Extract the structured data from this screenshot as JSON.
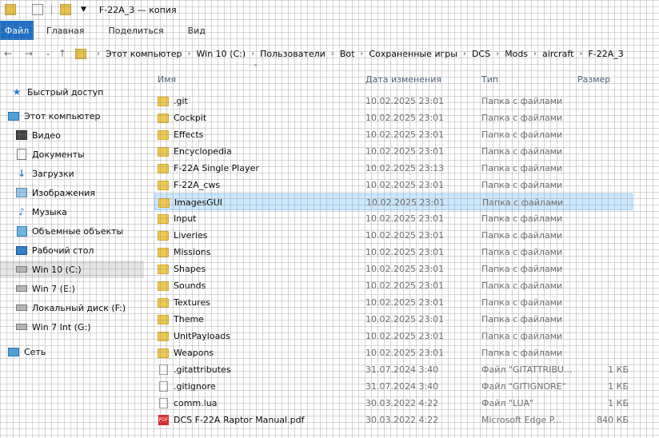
{
  "window": {
    "title": "F-22A_3 — копия"
  },
  "ribbon": {
    "tabs": [
      "Файл",
      "Главная",
      "Поделиться",
      "Вид"
    ]
  },
  "breadcrumb": [
    "Этот компьютер",
    "Win 10 (C:)",
    "Пользователи",
    "Bot",
    "Сохраненные игры",
    "DCS",
    "Mods",
    "aircraft",
    "F-22A_3"
  ],
  "columns": {
    "name": "Имя",
    "date": "Дата изменения",
    "type": "Тип",
    "size": "Размер"
  },
  "sidebar": {
    "items": [
      {
        "label": "Быстрый доступ",
        "icon": "star-icon"
      },
      {
        "label": "Этот компьютер",
        "icon": "computer-icon"
      },
      {
        "label": "Видео",
        "icon": "video-icon"
      },
      {
        "label": "Документы",
        "icon": "documents-icon"
      },
      {
        "label": "Загрузки",
        "icon": "download-icon"
      },
      {
        "label": "Изображения",
        "icon": "pictures-icon"
      },
      {
        "label": "Музыка",
        "icon": "music-icon"
      },
      {
        "label": "Объемные объекты",
        "icon": "3d-objects-icon"
      },
      {
        "label": "Рабочий стол",
        "icon": "desktop-icon"
      },
      {
        "label": "Win 10 (C:)",
        "icon": "drive-icon"
      },
      {
        "label": "Win 7 (E:)",
        "icon": "drive-icon"
      },
      {
        "label": "Локальный диск (F:)",
        "icon": "drive-icon"
      },
      {
        "label": "Win 7 Int (G:)",
        "icon": "drive-icon"
      },
      {
        "label": "Сеть",
        "icon": "network-icon"
      }
    ]
  },
  "files": [
    {
      "name": ".git",
      "date": "10.02.2025 23:01",
      "type": "Папка с файлами",
      "size": "",
      "kind": "folder"
    },
    {
      "name": "Cockpit",
      "date": "10.02.2025 23:01",
      "type": "Папка с файлами",
      "size": "",
      "kind": "folder"
    },
    {
      "name": "Effects",
      "date": "10.02.2025 23:01",
      "type": "Папка с файлами",
      "size": "",
      "kind": "folder"
    },
    {
      "name": "Encyclopedia",
      "date": "10.02.2025 23:01",
      "type": "Папка с файлами",
      "size": "",
      "kind": "folder"
    },
    {
      "name": "F-22A Single Player",
      "date": "10.02.2025 23:13",
      "type": "Папка с файлами",
      "size": "",
      "kind": "folder"
    },
    {
      "name": "F-22A_cws",
      "date": "10.02.2025 23:01",
      "type": "Папка с файлами",
      "size": "",
      "kind": "folder"
    },
    {
      "name": "ImagesGUI",
      "date": "10.02.2025 23:01",
      "type": "Папка с файлами",
      "size": "",
      "kind": "folder"
    },
    {
      "name": "Input",
      "date": "10.02.2025 23:01",
      "type": "Папка с файлами",
      "size": "",
      "kind": "folder"
    },
    {
      "name": "Liveries",
      "date": "10.02.2025 23:01",
      "type": "Папка с файлами",
      "size": "",
      "kind": "folder"
    },
    {
      "name": "Missions",
      "date": "10.02.2025 23:01",
      "type": "Папка с файлами",
      "size": "",
      "kind": "folder"
    },
    {
      "name": "Shapes",
      "date": "10.02.2025 23:01",
      "type": "Папка с файлами",
      "size": "",
      "kind": "folder"
    },
    {
      "name": "Sounds",
      "date": "10.02.2025 23:01",
      "type": "Папка с файлами",
      "size": "",
      "kind": "folder"
    },
    {
      "name": "Textures",
      "date": "10.02.2025 23:01",
      "type": "Папка с файлами",
      "size": "",
      "kind": "folder"
    },
    {
      "name": "Theme",
      "date": "10.02.2025 23:01",
      "type": "Папка с файлами",
      "size": "",
      "kind": "folder"
    },
    {
      "name": "UnitPayloads",
      "date": "10.02.2025 23:01",
      "type": "Папка с файлами",
      "size": "",
      "kind": "folder"
    },
    {
      "name": "Weapons",
      "date": "10.02.2025 23:01",
      "type": "Папка с файлами",
      "size": "",
      "kind": "folder"
    },
    {
      "name": ".gitattributes",
      "date": "31.07.2024 3:40",
      "type": "Файл \"GITATTRIBU...",
      "size": "1 КБ",
      "kind": "file"
    },
    {
      "name": ".gitignore",
      "date": "31.07.2024 3:40",
      "type": "Файл \"GITIGNORE\"",
      "size": "1 КБ",
      "kind": "file"
    },
    {
      "name": "comm.lua",
      "date": "30.03.2022 4:22",
      "type": "Файл \"LUA\"",
      "size": "1 КБ",
      "kind": "file"
    },
    {
      "name": "DCS F-22A Raptor Manual.pdf",
      "date": "30.03.2022 4:22",
      "type": "Microsoft Edge P...",
      "size": "840 КБ",
      "kind": "pdf"
    }
  ],
  "pdf_badge": "PDF"
}
